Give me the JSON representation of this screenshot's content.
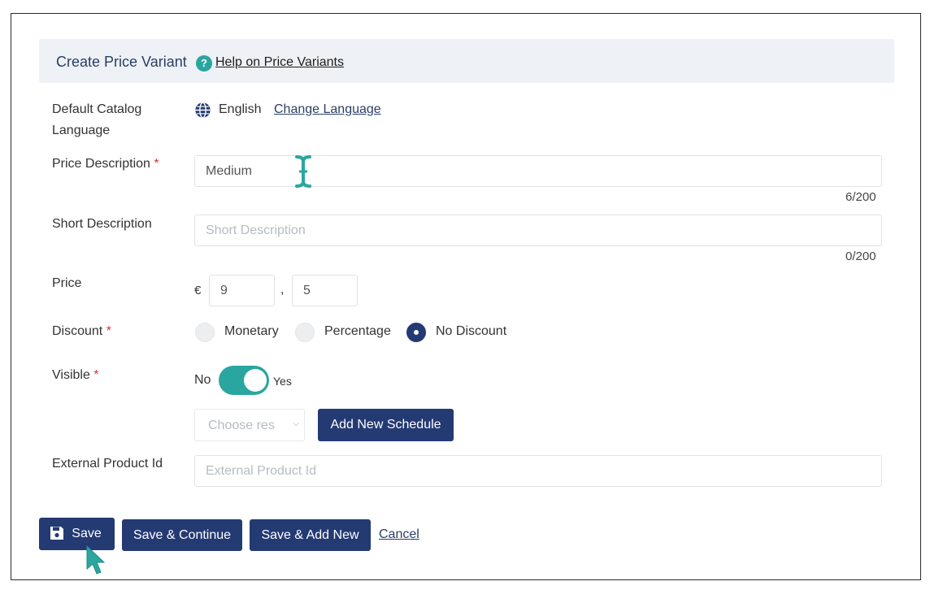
{
  "header": {
    "title": "Create Price Variant",
    "help_icon": "question-icon",
    "help_link": "Help on Price Variants"
  },
  "language": {
    "label": "Default Catalog Language",
    "icon": "globe-icon",
    "value": "English",
    "change_link": "Change Language"
  },
  "price_description": {
    "label": "Price Description",
    "required_mark": "*",
    "value": "Medium",
    "counter": "6/200"
  },
  "short_description": {
    "label": "Short Description",
    "placeholder": "Short Description",
    "counter": "0/200"
  },
  "price": {
    "label": "Price",
    "currency": "€",
    "whole": "9",
    "separator": ",",
    "decimal": "5"
  },
  "discount": {
    "label": "Discount",
    "required_mark": "*",
    "options": [
      "Monetary",
      "Percentage",
      "No Discount"
    ],
    "selected": "No Discount"
  },
  "visible": {
    "label": "Visible",
    "required_mark": "*",
    "off_label": "No",
    "on_label": "Yes",
    "accent": "#2aa6a0"
  },
  "schedule": {
    "select_value": "Choose res",
    "add_button": "Add New Schedule"
  },
  "external_id": {
    "label": "External Product Id",
    "placeholder": "External Product Id"
  },
  "actions": {
    "save": "Save",
    "save_continue": "Save & Continue",
    "save_add_new": "Save & Add New",
    "cancel": "Cancel"
  },
  "colors": {
    "primary": "#243a73",
    "accent": "#2aa6a0",
    "required": "#dd3333"
  }
}
